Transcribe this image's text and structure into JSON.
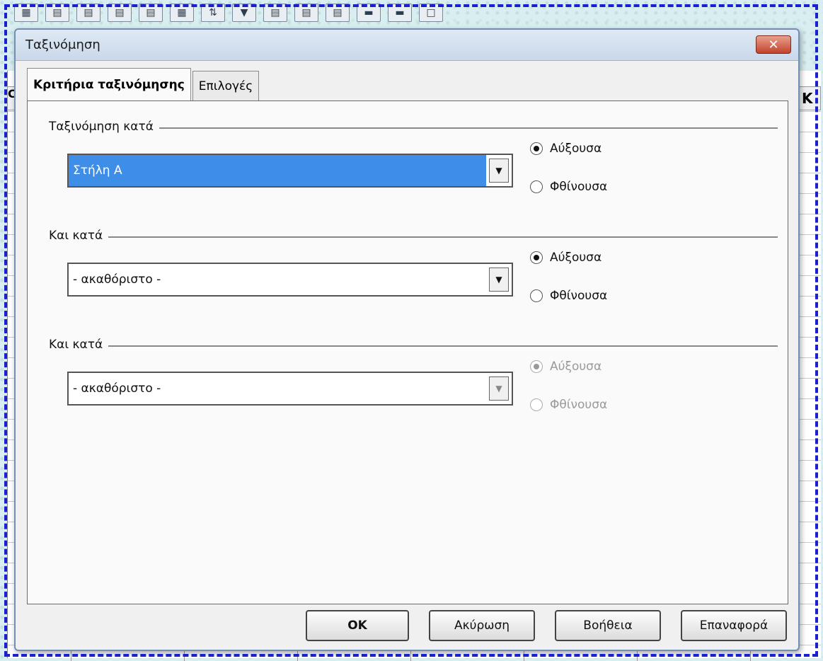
{
  "toolbar": {
    "icons": [
      "grid-icon",
      "table-icon",
      "table-icon",
      "table-icon",
      "table-icon",
      "table-icon",
      "sort-icon",
      "filter-icon",
      "table-icon",
      "table-icon",
      "table-icon",
      "chart-icon",
      "chart-icon",
      "frame-icon"
    ]
  },
  "sheet": {
    "right_column_header": "K",
    "left_column_header": "C"
  },
  "dialog": {
    "title": "Ταξινόμηση",
    "close_symbol": "✕",
    "tabs": [
      {
        "label": "Κριτήρια ταξινόμησης",
        "active": true
      },
      {
        "label": "Επιλογές",
        "active": false
      }
    ],
    "sort_keys": [
      {
        "label": "Ταξινόμηση κατά",
        "value": "Στήλη A",
        "selected": true,
        "disabled": false,
        "ascending_label": "Αύξουσα",
        "descending_label": "Φθίνουσα",
        "order": "ascending"
      },
      {
        "label": "Και κατά",
        "value": "- ακαθόριστο -",
        "selected": false,
        "disabled": false,
        "ascending_label": "Αύξουσα",
        "descending_label": "Φθίνουσα",
        "order": "ascending"
      },
      {
        "label": "Και κατά",
        "value": "- ακαθόριστο -",
        "selected": false,
        "disabled": true,
        "ascending_label": "Αύξουσα",
        "descending_label": "Φθίνουσα",
        "order": "ascending"
      }
    ],
    "buttons": {
      "ok": "OK",
      "cancel": "Ακύρωση",
      "help": "Βοήθεια",
      "reset": "Επαναφορά"
    }
  }
}
